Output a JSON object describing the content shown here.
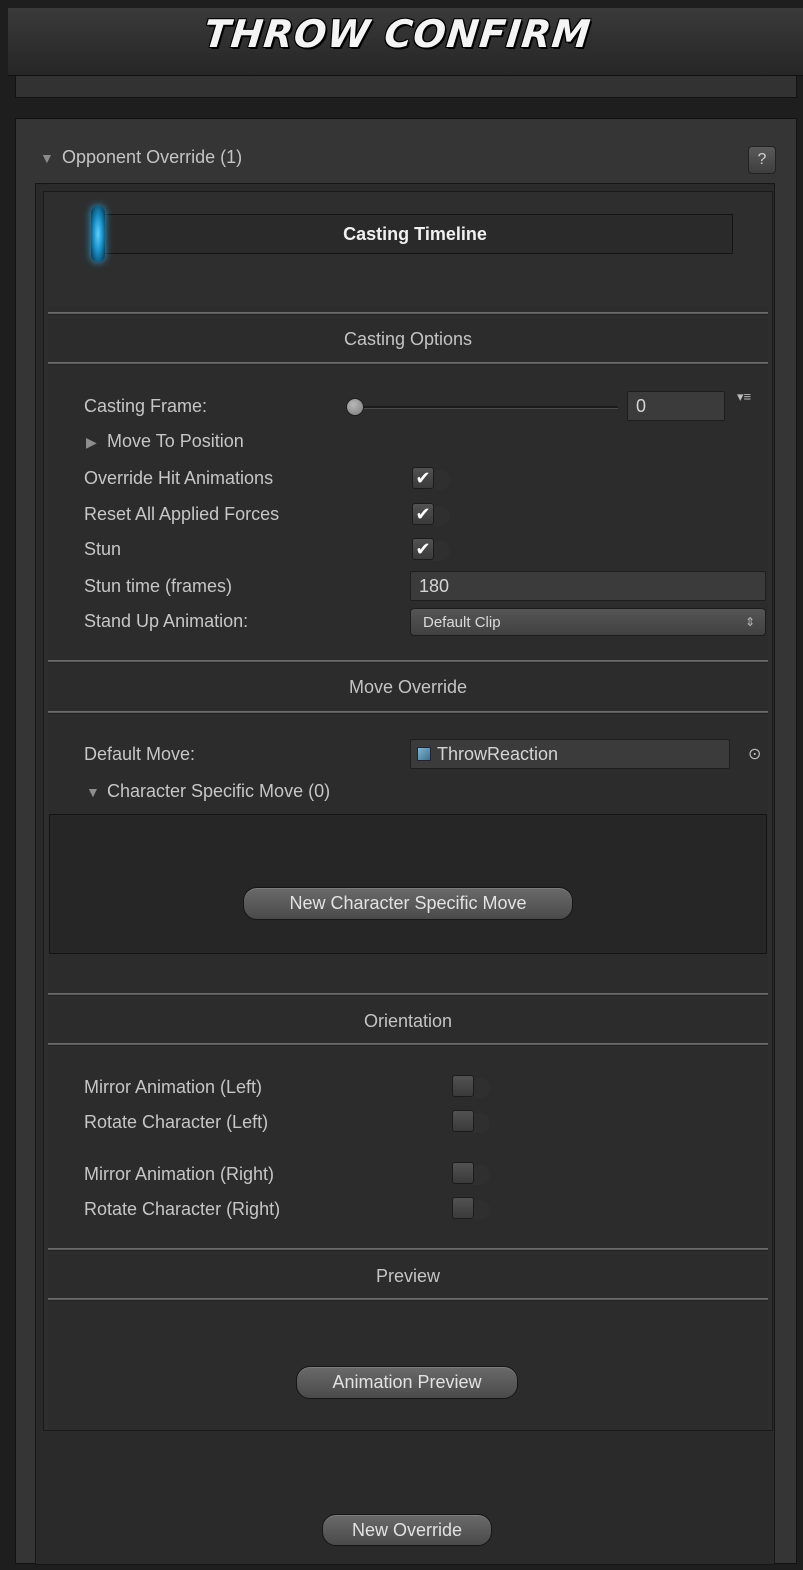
{
  "window": {
    "title": "THROW CONFIRM"
  },
  "override": {
    "foldout_arrow": "▼",
    "label": "Opponent Override (1)",
    "help": "?"
  },
  "timeline": {
    "label": "Casting Timeline"
  },
  "casting_options": {
    "header": "Casting Options",
    "casting_frame_label": "Casting Frame:",
    "casting_frame_value": "0",
    "casting_frame_slider_fraction": 0.0,
    "menu_icon": "▾≡",
    "move_to_position_arrow": "▶",
    "move_to_position_label": "Move To Position",
    "override_hit_animations_label": "Override Hit Animations",
    "override_hit_animations_checked": true,
    "reset_forces_label": "Reset All Applied Forces",
    "reset_forces_checked": true,
    "stun_label": "Stun",
    "stun_checked": true,
    "stun_time_label": "Stun time (frames)",
    "stun_time_value": "180",
    "stand_up_label": "Stand Up Animation:",
    "stand_up_value": "Default Clip",
    "stand_up_arrows": "⇕"
  },
  "move_override": {
    "header": "Move Override",
    "default_move_label": "Default Move:",
    "default_move_value": "ThrowReaction",
    "picker_icon": "⊙",
    "char_specific_arrow": "▼",
    "char_specific_label": "Character Specific Move (0)",
    "new_char_move_button": "New Character Specific Move"
  },
  "orientation": {
    "header": "Orientation",
    "mirror_left_label": "Mirror Animation (Left)",
    "rotate_left_label": "Rotate Character (Left)",
    "mirror_right_label": "Mirror Animation (Right)",
    "rotate_right_label": "Rotate Character (Right)"
  },
  "preview": {
    "header": "Preview",
    "animation_preview_button": "Animation Preview"
  },
  "new_override_button": "New Override",
  "check_glyph": "✔"
}
